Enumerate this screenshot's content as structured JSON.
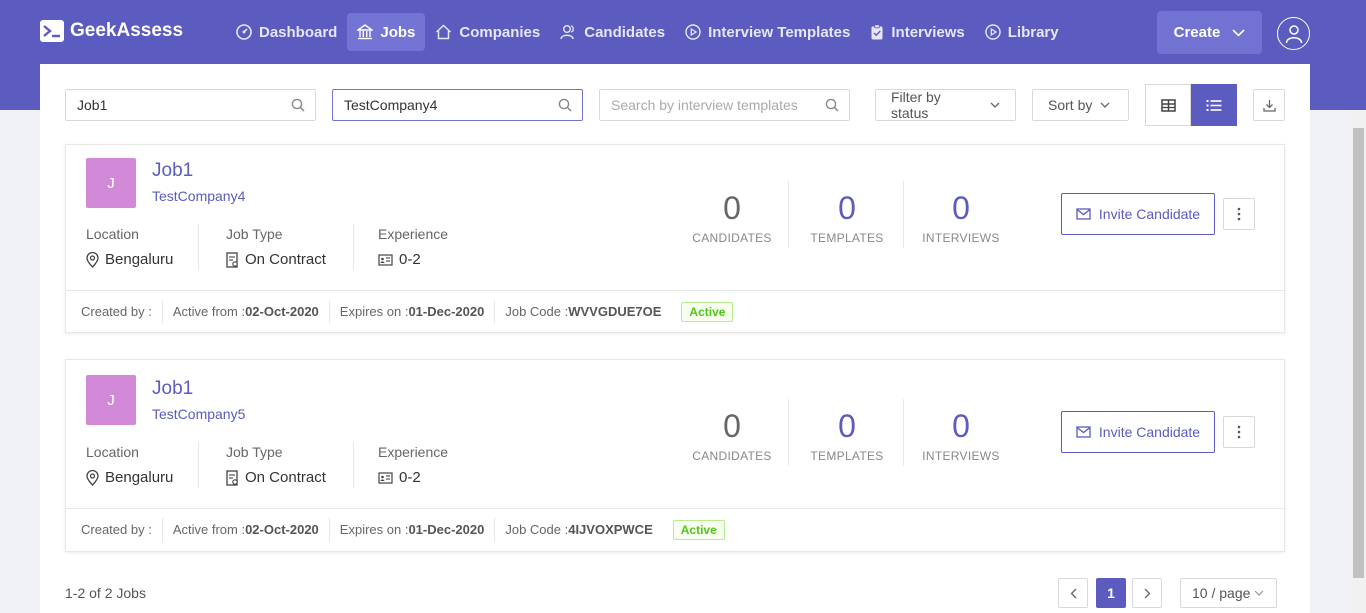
{
  "brand": {
    "name": "GeekAssess",
    "accent": "#5b5bc0"
  },
  "nav": {
    "items": [
      {
        "label": "Dashboard",
        "icon": "dashboard-icon"
      },
      {
        "label": "Jobs",
        "icon": "bank-icon"
      },
      {
        "label": "Companies",
        "icon": "home-icon"
      },
      {
        "label": "Candidates",
        "icon": "users-icon"
      },
      {
        "label": "Interview Templates",
        "icon": "play-circle-icon"
      },
      {
        "label": "Interviews",
        "icon": "clipboard-icon"
      },
      {
        "label": "Library",
        "icon": "play-circle-icon"
      }
    ],
    "active": "Jobs",
    "create_label": "Create"
  },
  "filters": {
    "job_search": "Job1",
    "company_search": "TestCompany4",
    "template_search_placeholder": "Search by interview templates",
    "status_filter": "Filter by status",
    "sort": "Sort by"
  },
  "jobs": [
    {
      "initial": "J",
      "title": "Job1",
      "company": "TestCompany4",
      "location_label": "Location",
      "location": "Bengaluru",
      "job_type_label": "Job Type",
      "job_type": "On Contract",
      "experience_label": "Experience",
      "experience": "0-2",
      "candidates": "0",
      "candidates_label": "CANDIDATES",
      "templates": "0",
      "templates_label": "TEMPLATES",
      "interviews": "0",
      "interviews_label": "INTERVIEWS",
      "invite_label": "Invite Candidate",
      "created_by_label": "Created by :",
      "active_from_label": "Active from :",
      "active_from": "02-Oct-2020",
      "expires_label": "Expires on :",
      "expires": "01-Dec-2020",
      "code_label": "Job Code :",
      "code": "WVVGDUE7OE",
      "status": "Active"
    },
    {
      "initial": "J",
      "title": "Job1",
      "company": "TestCompany5",
      "location_label": "Location",
      "location": "Bengaluru",
      "job_type_label": "Job Type",
      "job_type": "On Contract",
      "experience_label": "Experience",
      "experience": "0-2",
      "candidates": "0",
      "candidates_label": "CANDIDATES",
      "templates": "0",
      "templates_label": "TEMPLATES",
      "interviews": "0",
      "interviews_label": "INTERVIEWS",
      "invite_label": "Invite Candidate",
      "created_by_label": "Created by :",
      "active_from_label": "Active from :",
      "active_from": "02-Oct-2020",
      "expires_label": "Expires on :",
      "expires": "01-Dec-2020",
      "code_label": "Job Code :",
      "code": "4IJVOXPWCE",
      "status": "Active"
    }
  ],
  "pagination": {
    "summary": "1-2 of 2 Jobs",
    "current_page": "1",
    "page_size": "10 / page"
  }
}
